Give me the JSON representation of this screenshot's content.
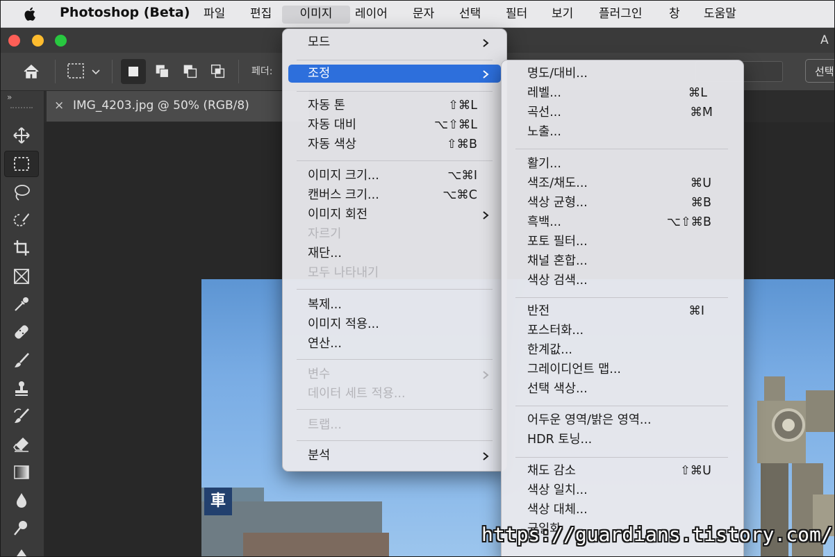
{
  "menubar": {
    "apple_icon": "apple-logo-icon",
    "app_name": "Photoshop (Beta)",
    "items": [
      "파일",
      "편집",
      "이미지",
      "레이어",
      "문자",
      "선택",
      "필터",
      "보기",
      "플러그인",
      "창",
      "도움말"
    ],
    "active_item": "이미지"
  },
  "window": {
    "title_fragment": "A",
    "traffic_light_colors": {
      "close": "#fe5f57",
      "minimize": "#febc2e",
      "zoom": "#28c840"
    }
  },
  "options_bar": {
    "feather_label": "페더:",
    "select_button_label": "선택"
  },
  "toolbar": {
    "collapse_label": "»",
    "tools": [
      "move-tool",
      "rectangular-marquee-tool",
      "lasso-tool",
      "object-selection-tool",
      "crop-tool",
      "frame-tool",
      "eyedropper-tool",
      "spot-healing-tool",
      "brush-tool",
      "clone-stamp-tool",
      "history-brush-tool",
      "eraser-tool",
      "gradient-tool",
      "blur-tool",
      "dodge-tool",
      "pen-tool"
    ],
    "selected_tool": "rectangular-marquee-tool"
  },
  "document": {
    "tab_title": "IMG_4203.jpg @ 50% (RGB/8)",
    "close_label": "×",
    "sign_char": "車"
  },
  "image_menu": {
    "items": [
      {
        "label": "모드",
        "shortcut": "",
        "submenu": true,
        "disabled": false
      },
      {
        "label": "조정",
        "shortcut": "",
        "submenu": true,
        "disabled": false,
        "highlighted": true
      },
      {
        "label": "자동 톤",
        "shortcut": "⇧⌘L",
        "disabled": false
      },
      {
        "label": "자동 대비",
        "shortcut": "⌥⇧⌘L",
        "disabled": false
      },
      {
        "label": "자동 색상",
        "shortcut": "⇧⌘B",
        "disabled": false
      },
      {
        "label": "이미지 크기...",
        "shortcut": "⌥⌘I",
        "disabled": false
      },
      {
        "label": "캔버스 크기...",
        "shortcut": "⌥⌘C",
        "disabled": false
      },
      {
        "label": "이미지 회전",
        "shortcut": "",
        "submenu": true,
        "disabled": false
      },
      {
        "label": "자르기",
        "shortcut": "",
        "disabled": true
      },
      {
        "label": "재단...",
        "shortcut": "",
        "disabled": false
      },
      {
        "label": "모두 나타내기",
        "shortcut": "",
        "disabled": true
      },
      {
        "label": "복제...",
        "shortcut": "",
        "disabled": false
      },
      {
        "label": "이미지 적용...",
        "shortcut": "",
        "disabled": false
      },
      {
        "label": "연산...",
        "shortcut": "",
        "disabled": false
      },
      {
        "label": "변수",
        "shortcut": "",
        "submenu": true,
        "disabled": true
      },
      {
        "label": "데이터 세트 적용...",
        "shortcut": "",
        "disabled": true
      },
      {
        "label": "트랩...",
        "shortcut": "",
        "disabled": true
      },
      {
        "label": "분석",
        "shortcut": "",
        "submenu": true,
        "disabled": false
      }
    ]
  },
  "adjust_menu": {
    "items": [
      {
        "label": "명도/대비...",
        "shortcut": ""
      },
      {
        "label": "레벨...",
        "shortcut": "⌘L"
      },
      {
        "label": "곡선...",
        "shortcut": "⌘M"
      },
      {
        "label": "노출...",
        "shortcut": ""
      },
      {
        "label": "활기...",
        "shortcut": ""
      },
      {
        "label": "색조/채도...",
        "shortcut": "⌘U"
      },
      {
        "label": "색상 균형...",
        "shortcut": "⌘B"
      },
      {
        "label": "흑백...",
        "shortcut": "⌥⇧⌘B"
      },
      {
        "label": "포토 필터...",
        "shortcut": ""
      },
      {
        "label": "채널 혼합...",
        "shortcut": ""
      },
      {
        "label": "색상 검색...",
        "shortcut": ""
      },
      {
        "label": "반전",
        "shortcut": "⌘I"
      },
      {
        "label": "포스터화...",
        "shortcut": ""
      },
      {
        "label": "한계값...",
        "shortcut": ""
      },
      {
        "label": "그레이디언트 맵...",
        "shortcut": ""
      },
      {
        "label": "선택 색상...",
        "shortcut": ""
      },
      {
        "label": "어두운 영역/밝은 영역...",
        "shortcut": ""
      },
      {
        "label": "HDR 토닝...",
        "shortcut": ""
      },
      {
        "label": "채도 감소",
        "shortcut": "⇧⌘U"
      },
      {
        "label": "색상 일치...",
        "shortcut": ""
      },
      {
        "label": "색상 대체...",
        "shortcut": ""
      },
      {
        "label": "균일화",
        "shortcut": ""
      }
    ]
  },
  "watermark": "https://guardians.tistory.com/"
}
